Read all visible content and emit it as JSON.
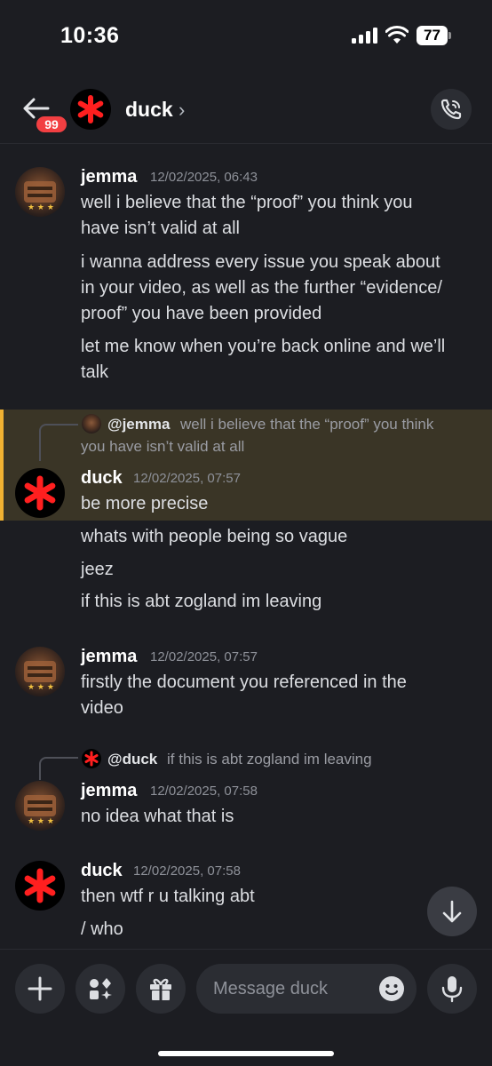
{
  "status_bar": {
    "time": "10:36",
    "battery": "77"
  },
  "header": {
    "unread_count": "99",
    "channel_name": "duck",
    "chevron": "›"
  },
  "messages": [
    {
      "author": "jemma",
      "timestamp": "12/02/2025, 06:43",
      "lines": [
        "well i believe that the “proof” you think you",
        "have isn’t valid at all",
        "i wanna address every issue you speak about",
        "in your video, as well as the further “evidence/",
        "proof” you have been provided",
        "let me know when you’re back online and we’ll",
        "talk"
      ]
    },
    {
      "reply": {
        "mention": "@jemma",
        "text_line1": "well i believe that the “proof” you think",
        "text_line2": "you have isn’t valid at all"
      },
      "author": "duck",
      "timestamp": "12/02/2025, 07:57",
      "lines": [
        "be more precise",
        "whats with people being so vague",
        "jeez",
        "if this is abt zogland im leaving"
      ]
    },
    {
      "author": "jemma",
      "timestamp": "12/02/2025, 07:57",
      "lines": [
        "firstly the document you referenced in the",
        "video"
      ]
    },
    {
      "reply": {
        "mention": "@duck",
        "text_line1": "if this is abt zogland im leaving"
      },
      "author": "jemma",
      "timestamp": "12/02/2025, 07:58",
      "lines": [
        "no idea what that is"
      ]
    },
    {
      "author": "duck",
      "timestamp": "12/02/2025, 07:58",
      "lines": [
        "then wtf r u talking abt",
        "/ who"
      ]
    }
  ],
  "composer": {
    "placeholder": "Message duck"
  },
  "colors": {
    "background": "#1c1d22",
    "highlight": "#3a3526",
    "highlight_bar": "#f0b232",
    "badge": "#f23f42",
    "duck_asterisk": "#ff1f1f"
  }
}
